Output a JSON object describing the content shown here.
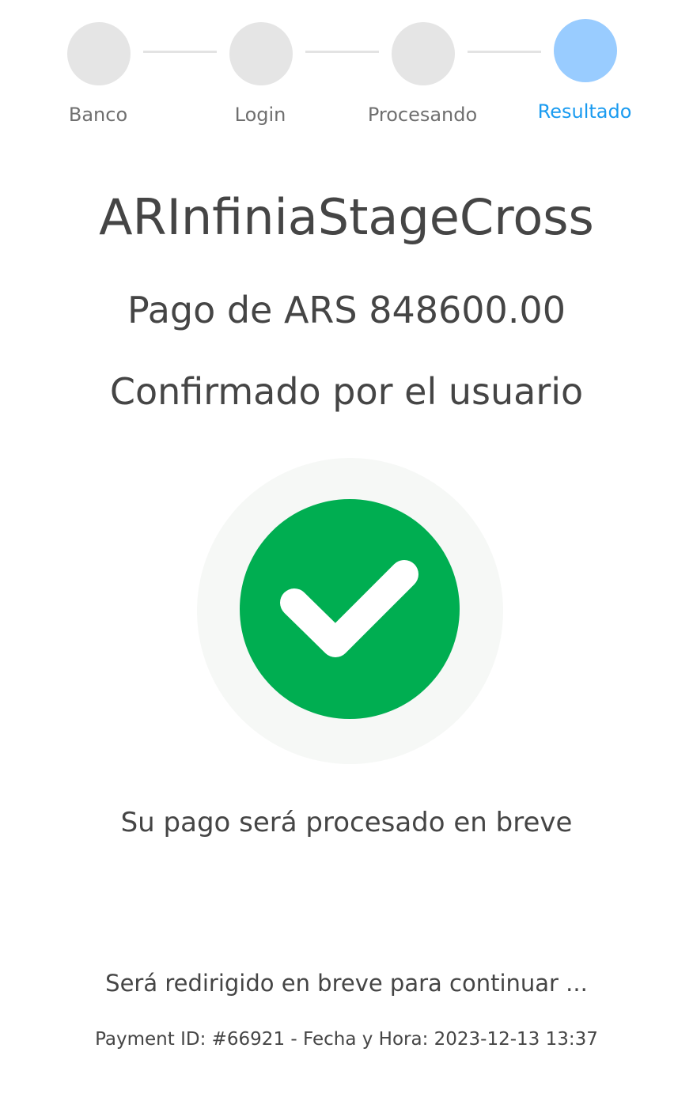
{
  "stepper": {
    "steps": [
      {
        "label": "Banco",
        "state": "completed"
      },
      {
        "label": "Login",
        "state": "completed"
      },
      {
        "label": "Procesando",
        "state": "completed"
      },
      {
        "label": "Resultado",
        "state": "active"
      }
    ],
    "colors": {
      "inactive": "#e5e5e5",
      "active": "#99ccff",
      "active_label": "#1a9bf0",
      "label": "#6f6f6f"
    }
  },
  "merchant": {
    "name": "ARInfiniaStageCross"
  },
  "payment": {
    "amount_text": "Pago de ARS 848600.00",
    "status_text": "Confirmado por el usuario",
    "info_text": "Su pago será procesado en breve",
    "redirect_text": "Será redirigido en breve para continuar ...",
    "meta_text": "Payment ID: #66921 - Fecha y Hora: 2023-12-13 13:37"
  },
  "status_icon": {
    "name": "check-circle-icon",
    "color": "#00ae51"
  }
}
